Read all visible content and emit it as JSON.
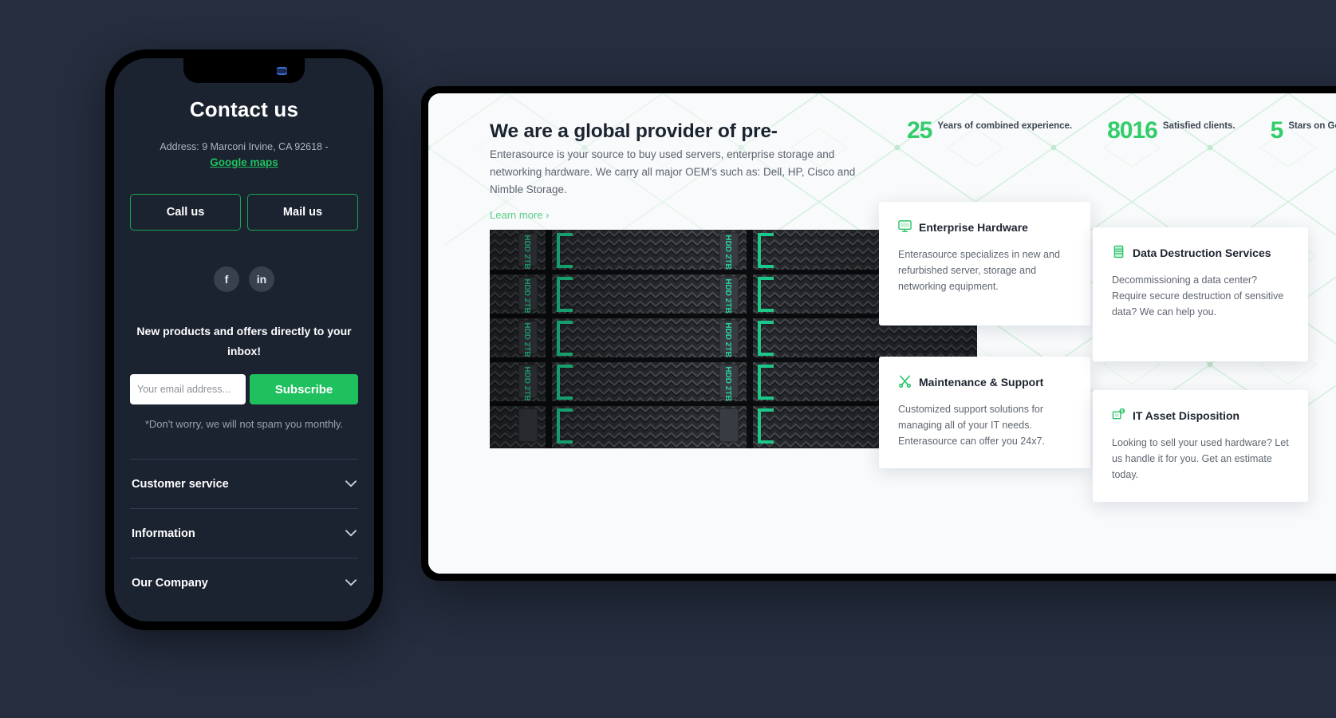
{
  "theme": {
    "page_background": "#252d3e",
    "accent_green": "#1fc15f",
    "stat_green": "#33cc6b",
    "link_green": "#5bcc87",
    "phone_screen": "#1b2230",
    "desktop_screen": "#f8fafb"
  },
  "phone": {
    "title": "Contact us",
    "address": "Address: 9 Marconi Irvine, CA 92618 -",
    "maps_link": "Google maps",
    "buttons": {
      "call": "Call us",
      "mail": "Mail us"
    },
    "social": [
      {
        "name": "facebook",
        "glyph": "f"
      },
      {
        "name": "linkedin",
        "glyph": "in"
      }
    ],
    "newsletter": {
      "headline": "New products and offers directly to your inbox!",
      "email_placeholder": "Your email address...",
      "email_value": "",
      "subscribe_label": "Subscribe",
      "disclaimer": "*Don't worry, we will not spam you monthly."
    },
    "accordion": [
      {
        "label": "Customer service",
        "chevron": "⌄"
      },
      {
        "label": "Information",
        "chevron": "⌄"
      },
      {
        "label": "Our Company",
        "chevron": "⌄"
      }
    ]
  },
  "desktop": {
    "hero": {
      "heading": "We are a global provider of pre-",
      "paragraph": "Enterasource is your source to buy used servers, enterprise storage and networking hardware. We carry all major OEM's such as: Dell, HP, Cisco and Nimble Storage.",
      "learn_more": "Learn more  ›"
    },
    "stats": [
      {
        "number": "25",
        "label": "Years of combined experience."
      },
      {
        "number": "8016",
        "label": "Satisfied clients."
      },
      {
        "number": "5",
        "label": "Stars on Google Business Reviews"
      }
    ],
    "photo_alt": "Rack of enterprise server HDD drive bays with green activity LEDs",
    "service_cards": [
      {
        "icon": "monitor-icon",
        "title": "Enterprise Hardware",
        "body": "Enterasource specializes in new and refurbished server, storage and networking equipment."
      },
      {
        "icon": "tools-icon",
        "title": "Maintenance & Support",
        "body": "Customized support solutions for managing all of your IT needs. Enterasource can offer you 24x7."
      },
      {
        "icon": "server-stack-icon",
        "title": "Data Destruction Services",
        "body": "Decommissioning a data center? Require secure destruction of sensitive data? We can help you."
      },
      {
        "icon": "asset-value-icon",
        "title": "IT Asset Disposition",
        "body": "Looking to sell your used hardware? Let us handle it for you. Get an estimate today."
      }
    ]
  }
}
